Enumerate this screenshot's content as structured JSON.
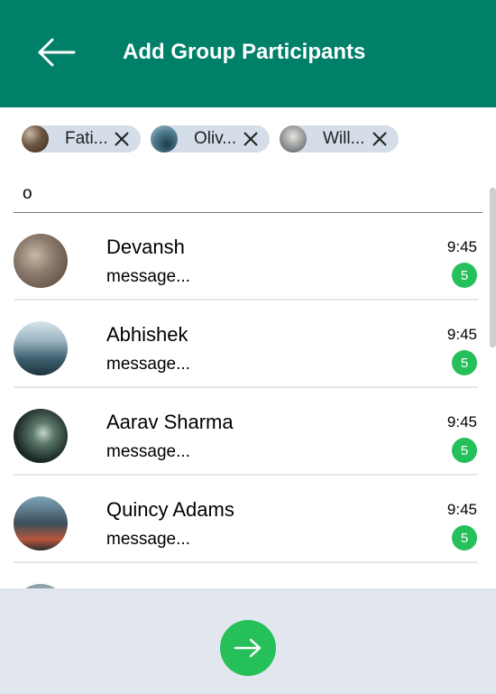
{
  "header": {
    "title": "Add Group Participants",
    "background": "#008069",
    "back_icon": "arrow-left-icon"
  },
  "selected": [
    {
      "name": "Fati...",
      "remove_icon": "close-icon"
    },
    {
      "name": "Oliv...",
      "remove_icon": "close-icon"
    },
    {
      "name": "Will...",
      "remove_icon": "close-icon"
    }
  ],
  "search": {
    "value": "o",
    "placeholder": ""
  },
  "contacts": [
    {
      "name": "Devansh",
      "message": "message...",
      "time": "9:45",
      "unread": "5"
    },
    {
      "name": "Abhishek",
      "message": "message...",
      "time": "9:45",
      "unread": "5"
    },
    {
      "name": "Aarav Sharma",
      "message": "message...",
      "time": "9:45",
      "unread": "5"
    },
    {
      "name": "Quincy Adams",
      "message": "message...",
      "time": "9:45",
      "unread": "5"
    }
  ],
  "footer": {
    "next_icon": "arrow-right-icon"
  },
  "colors": {
    "accent": "#008069",
    "badge": "#25c05a",
    "chip": "#d4dde8",
    "footer": "#e2e6ee"
  }
}
